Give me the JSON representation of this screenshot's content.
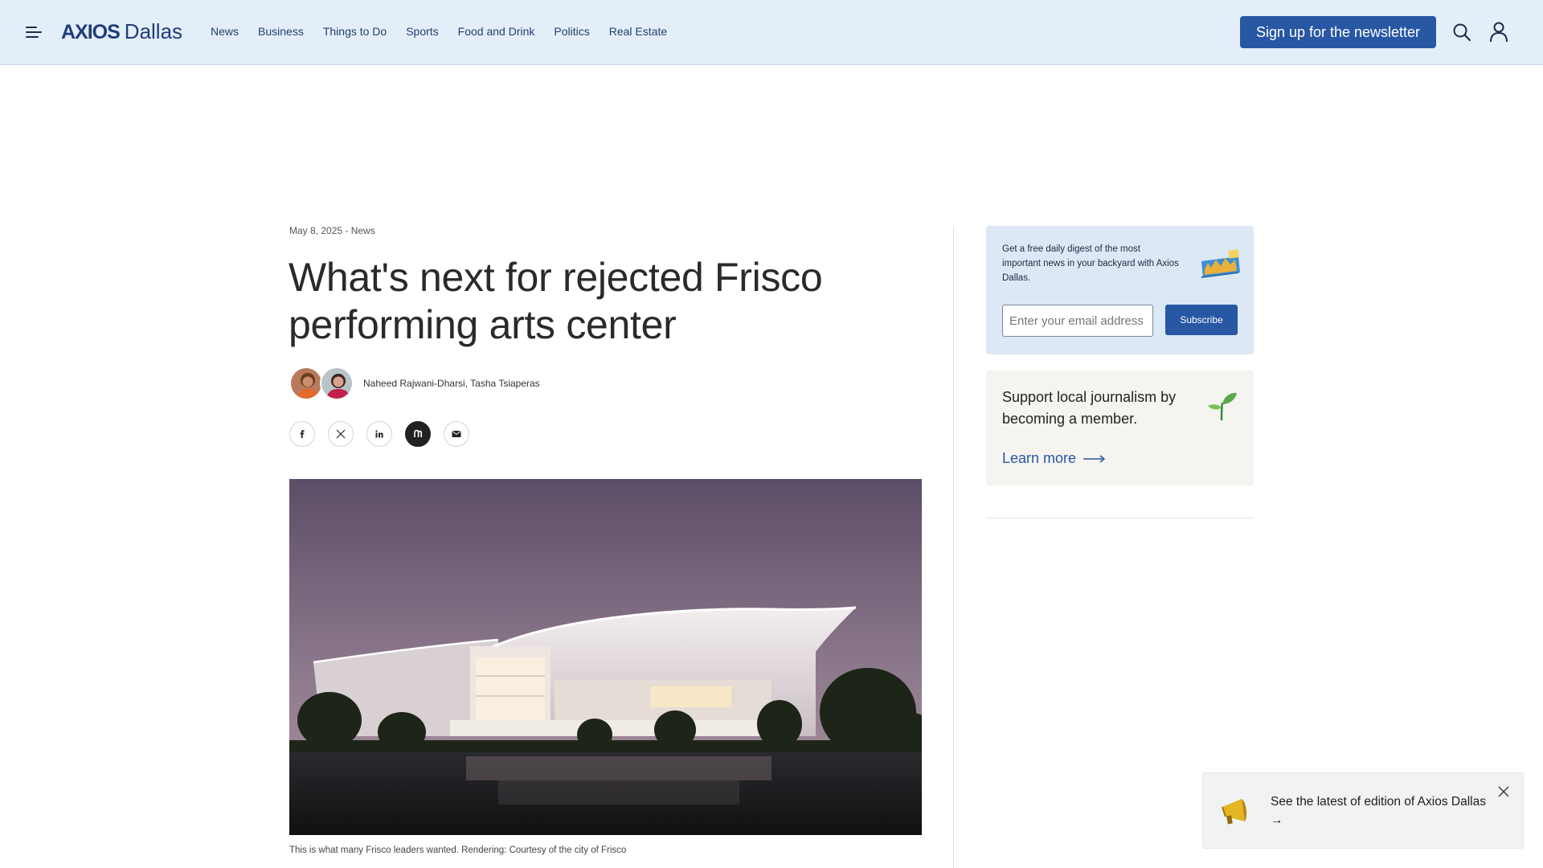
{
  "header": {
    "logo_brand": "AXIOS",
    "logo_city": "Dallas",
    "nav": [
      "News",
      "Business",
      "Things to Do",
      "Sports",
      "Food and Drink",
      "Politics",
      "Real Estate"
    ],
    "signup_label": "Sign up for the newsletter",
    "brand_color": "#2857a4"
  },
  "article": {
    "meta": "May 8, 2025 - News",
    "title": "What's next for rejected Frisco performing arts center",
    "byline": "Naheed Rajwani-Dharsi, Tasha Tsiaperas",
    "share_icons": [
      "facebook-icon",
      "x-icon",
      "linkedin-icon",
      "newsletter-icon",
      "email-icon"
    ],
    "caption": "This is what many Frisco leaders wanted. Rendering: Courtesy of the city of Frisco"
  },
  "sidebar": {
    "newsletter_text": "Get a free daily digest of the most important news in your backyard with Axios Dallas.",
    "email_placeholder": "Enter your email address",
    "subscribe_label": "Subscribe",
    "member_text": "Support local journalism by becoming a member.",
    "learn_more": "Learn more"
  },
  "toast": {
    "text": "See the latest of edition of Axios Dallas →"
  }
}
